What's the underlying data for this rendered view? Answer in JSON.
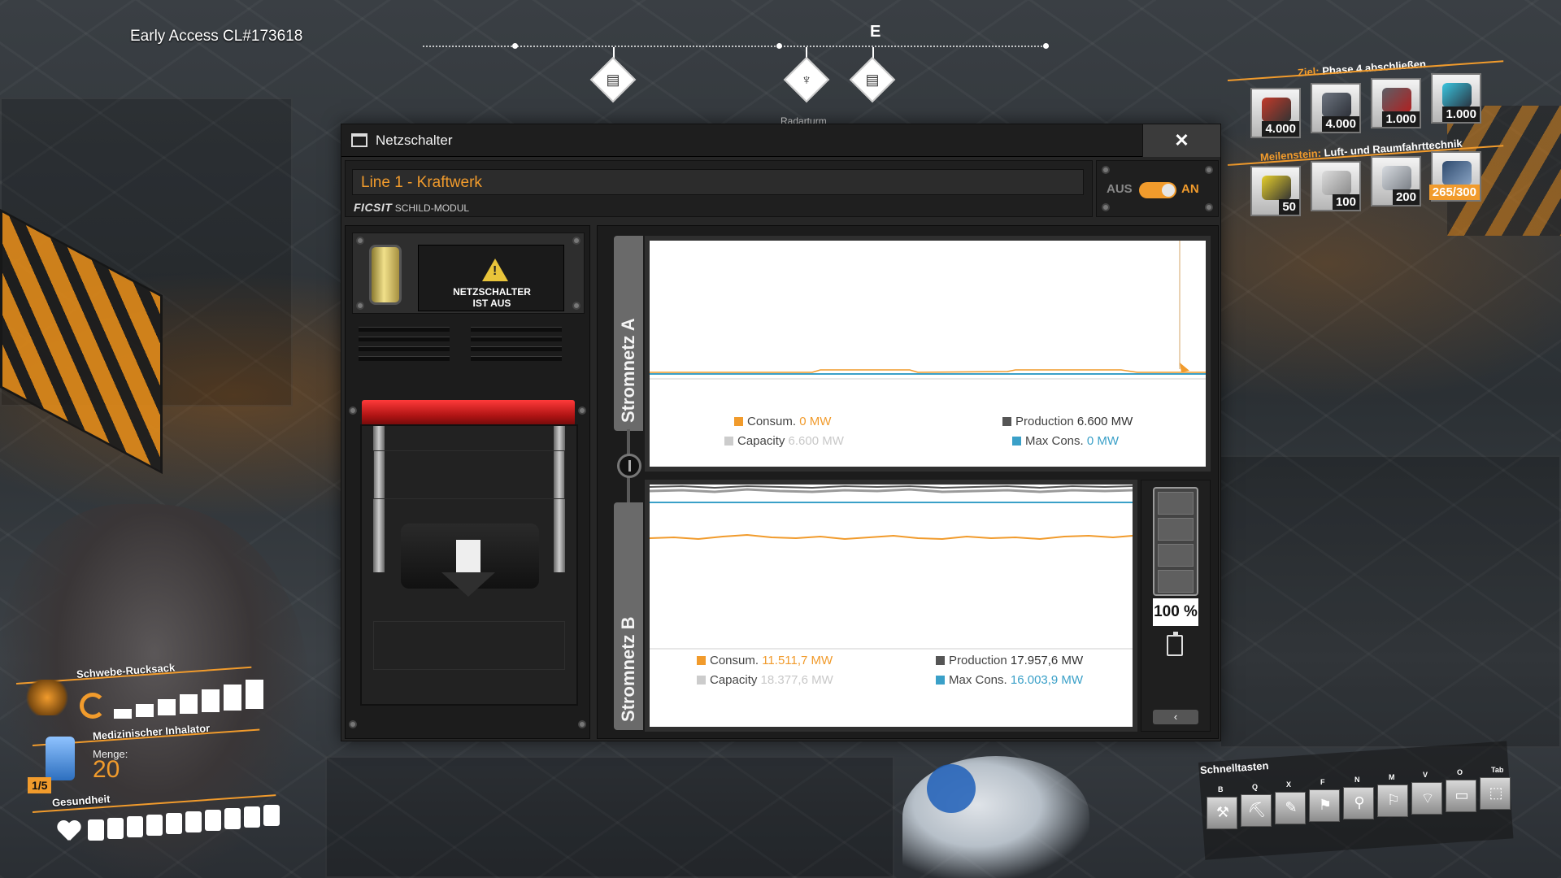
{
  "hud": {
    "build": "Early Access CL#173618",
    "compass_letter": "E",
    "marker_label": "Radarturm"
  },
  "goals": {
    "goal_label": "Ziel:",
    "goal_value": "Phase 4 abschließen",
    "goal_items": [
      "4.000",
      "4.000",
      "1.000",
      "1.000"
    ],
    "milestone_label": "Meilenstein:",
    "milestone_value": "Luft- und Raumfahrttechnik",
    "milestone_items": [
      "50",
      "100",
      "200",
      "265/300"
    ]
  },
  "window": {
    "title": "Netzschalter",
    "close": "✕",
    "name": "Line 1 - Kraftwerk",
    "brand_logo": "FICSIT",
    "brand_module": "SCHILD-MODUL",
    "toggle_off": "AUS",
    "toggle_on": "AN",
    "status": "NETZSCHALTER\nIST AUS"
  },
  "grid_a": {
    "label": "Stromnetz A",
    "consum_label": "Consum.",
    "consum_value": "0 MW",
    "production_label": "Production",
    "production_value": "6.600 MW",
    "capacity_label": "Capacity",
    "capacity_value": "6.600 MW",
    "maxcons_label": "Max Cons.",
    "maxcons_value": "0 MW"
  },
  "grid_b": {
    "label": "Stromnetz B",
    "consum_label": "Consum.",
    "consum_value": "11.511,7 MW",
    "production_label": "Production",
    "production_value": "17.957,6 MW",
    "capacity_label": "Capacity",
    "capacity_value": "18.377,6 MW",
    "maxcons_label": "Max Cons.",
    "maxcons_value": "16.003,9 MW",
    "battery_percent": "100 %",
    "battery_fill": 1.0,
    "collapse_glyph": "‹"
  },
  "player": {
    "jetpack_label": "Schwebe-Rucksack",
    "jetpack_fuel": 1.0,
    "inhaler_label": "Medizinischer Inhalator",
    "qty_label": "Menge:",
    "qty_value": "20",
    "slot": "1/5",
    "health_label": "Gesundheit",
    "health_fill": 1.0
  },
  "hotkeys": {
    "title": "Schnelltasten",
    "keys": [
      "B",
      "Q",
      "X",
      "F",
      "N",
      "M",
      "V",
      "O",
      "Tab"
    ]
  },
  "colors": {
    "accent": "#f19b2c",
    "production": "#555555",
    "capacity": "#cccccc",
    "maxcons": "#3aa0c8"
  }
}
